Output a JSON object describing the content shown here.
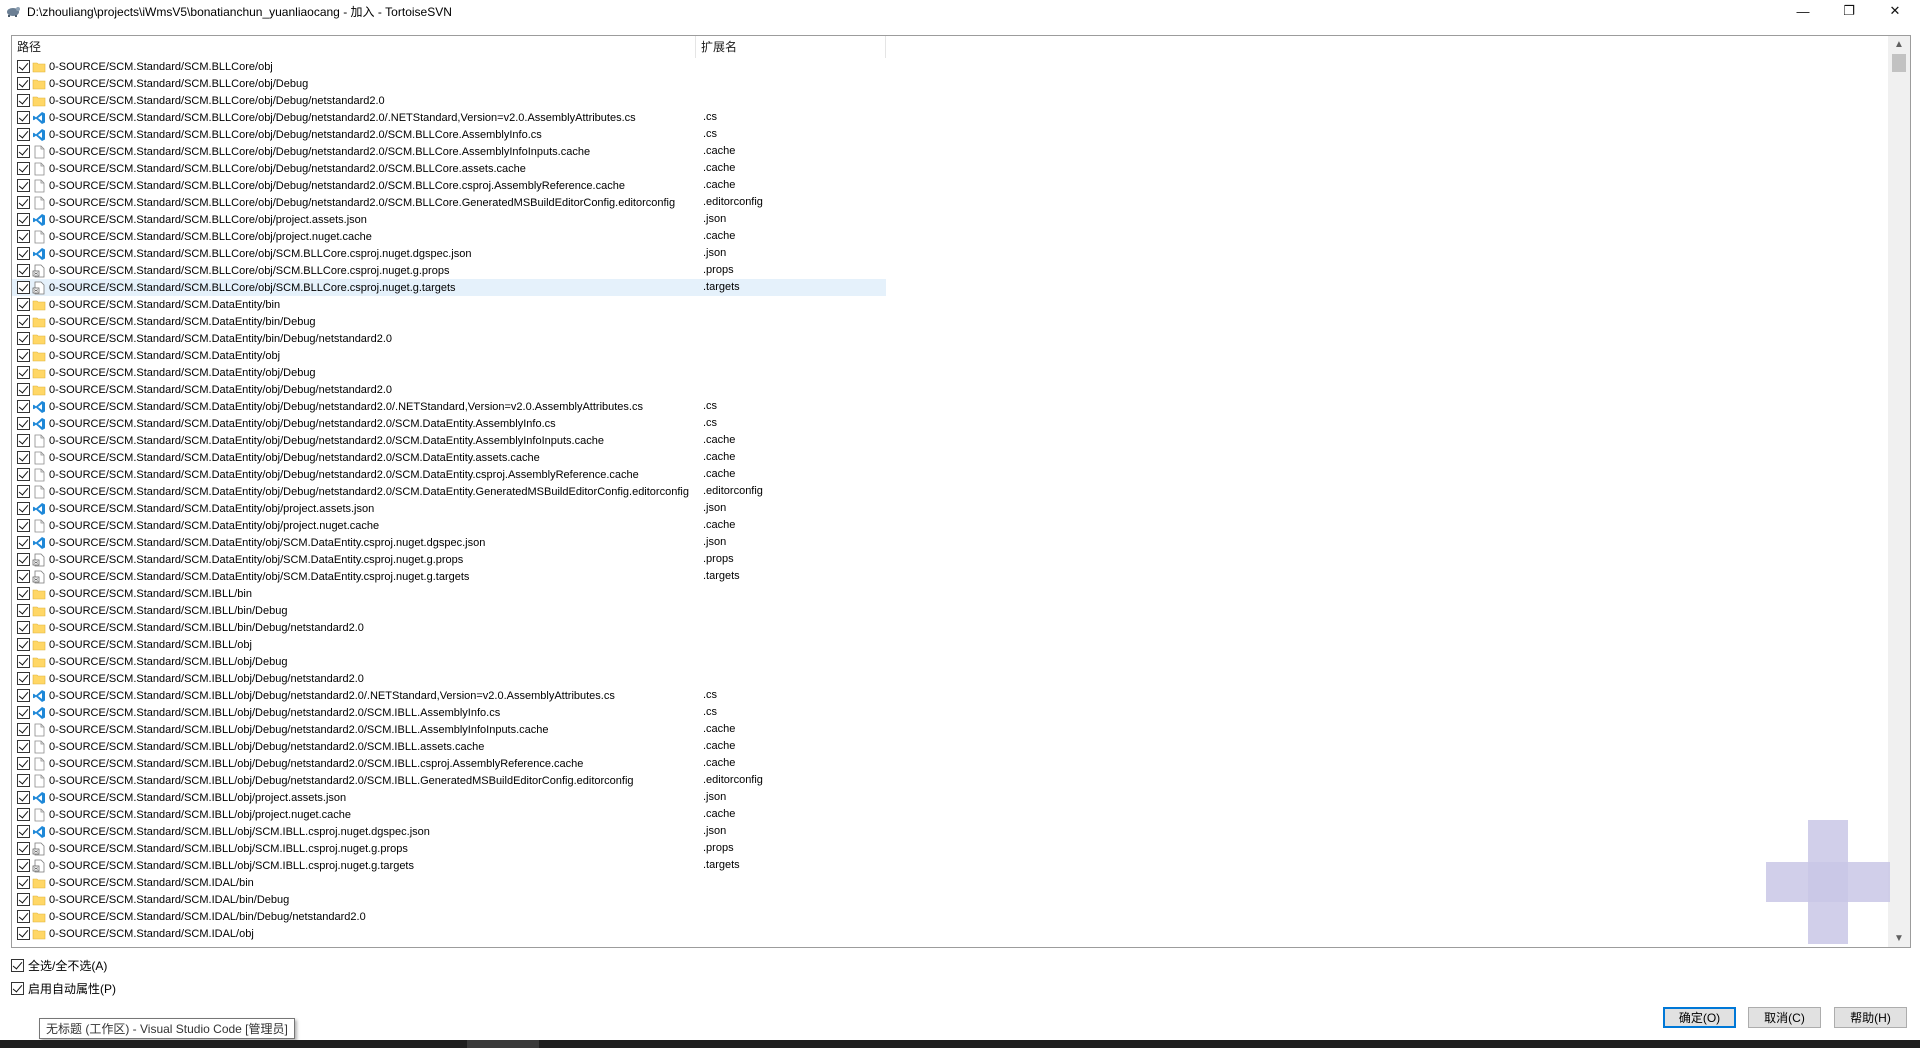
{
  "window": {
    "title": "D:\\zhouliang\\projects\\iWmsV5\\bonatianchun_yuanliaocang - 加入 - TortoiseSVN",
    "minimize_glyph": "—",
    "maximize_glyph": "❐",
    "close_glyph": "✕"
  },
  "list": {
    "columns": {
      "path": "路径",
      "ext": "扩展名"
    },
    "rows": [
      {
        "path": "0-SOURCE/SCM.Standard/SCM.BLLCore/obj",
        "ext": "",
        "icon": "folder-icon"
      },
      {
        "path": "0-SOURCE/SCM.Standard/SCM.BLLCore/obj/Debug",
        "ext": "",
        "icon": "folder-icon"
      },
      {
        "path": "0-SOURCE/SCM.Standard/SCM.BLLCore/obj/Debug/netstandard2.0",
        "ext": "",
        "icon": "folder-icon"
      },
      {
        "path": "0-SOURCE/SCM.Standard/SCM.BLLCore/obj/Debug/netstandard2.0/.NETStandard,Version=v2.0.AssemblyAttributes.cs",
        "ext": ".cs",
        "icon": "vscode-icon"
      },
      {
        "path": "0-SOURCE/SCM.Standard/SCM.BLLCore/obj/Debug/netstandard2.0/SCM.BLLCore.AssemblyInfo.cs",
        "ext": ".cs",
        "icon": "vscode-icon"
      },
      {
        "path": "0-SOURCE/SCM.Standard/SCM.BLLCore/obj/Debug/netstandard2.0/SCM.BLLCore.AssemblyInfoInputs.cache",
        "ext": ".cache",
        "icon": "file-icon"
      },
      {
        "path": "0-SOURCE/SCM.Standard/SCM.BLLCore/obj/Debug/netstandard2.0/SCM.BLLCore.assets.cache",
        "ext": ".cache",
        "icon": "file-icon"
      },
      {
        "path": "0-SOURCE/SCM.Standard/SCM.BLLCore/obj/Debug/netstandard2.0/SCM.BLLCore.csproj.AssemblyReference.cache",
        "ext": ".cache",
        "icon": "file-icon"
      },
      {
        "path": "0-SOURCE/SCM.Standard/SCM.BLLCore/obj/Debug/netstandard2.0/SCM.BLLCore.GeneratedMSBuildEditorConfig.editorconfig",
        "ext": ".editorconfig",
        "icon": "file-icon"
      },
      {
        "path": "0-SOURCE/SCM.Standard/SCM.BLLCore/obj/project.assets.json",
        "ext": ".json",
        "icon": "vscode-icon"
      },
      {
        "path": "0-SOURCE/SCM.Standard/SCM.BLLCore/obj/project.nuget.cache",
        "ext": ".cache",
        "icon": "file-icon"
      },
      {
        "path": "0-SOURCE/SCM.Standard/SCM.BLLCore/obj/SCM.BLLCore.csproj.nuget.dgspec.json",
        "ext": ".json",
        "icon": "vscode-icon"
      },
      {
        "path": "0-SOURCE/SCM.Standard/SCM.BLLCore/obj/SCM.BLLCore.csproj.nuget.g.props",
        "ext": ".props",
        "icon": "xml-file-icon"
      },
      {
        "path": "0-SOURCE/SCM.Standard/SCM.BLLCore/obj/SCM.BLLCore.csproj.nuget.g.targets",
        "ext": ".targets",
        "icon": "xml-file-icon",
        "selected": true
      },
      {
        "path": "0-SOURCE/SCM.Standard/SCM.DataEntity/bin",
        "ext": "",
        "icon": "folder-icon"
      },
      {
        "path": "0-SOURCE/SCM.Standard/SCM.DataEntity/bin/Debug",
        "ext": "",
        "icon": "folder-icon"
      },
      {
        "path": "0-SOURCE/SCM.Standard/SCM.DataEntity/bin/Debug/netstandard2.0",
        "ext": "",
        "icon": "folder-icon"
      },
      {
        "path": "0-SOURCE/SCM.Standard/SCM.DataEntity/obj",
        "ext": "",
        "icon": "folder-icon"
      },
      {
        "path": "0-SOURCE/SCM.Standard/SCM.DataEntity/obj/Debug",
        "ext": "",
        "icon": "folder-icon"
      },
      {
        "path": "0-SOURCE/SCM.Standard/SCM.DataEntity/obj/Debug/netstandard2.0",
        "ext": "",
        "icon": "folder-icon"
      },
      {
        "path": "0-SOURCE/SCM.Standard/SCM.DataEntity/obj/Debug/netstandard2.0/.NETStandard,Version=v2.0.AssemblyAttributes.cs",
        "ext": ".cs",
        "icon": "vscode-icon"
      },
      {
        "path": "0-SOURCE/SCM.Standard/SCM.DataEntity/obj/Debug/netstandard2.0/SCM.DataEntity.AssemblyInfo.cs",
        "ext": ".cs",
        "icon": "vscode-icon"
      },
      {
        "path": "0-SOURCE/SCM.Standard/SCM.DataEntity/obj/Debug/netstandard2.0/SCM.DataEntity.AssemblyInfoInputs.cache",
        "ext": ".cache",
        "icon": "file-icon"
      },
      {
        "path": "0-SOURCE/SCM.Standard/SCM.DataEntity/obj/Debug/netstandard2.0/SCM.DataEntity.assets.cache",
        "ext": ".cache",
        "icon": "file-icon"
      },
      {
        "path": "0-SOURCE/SCM.Standard/SCM.DataEntity/obj/Debug/netstandard2.0/SCM.DataEntity.csproj.AssemblyReference.cache",
        "ext": ".cache",
        "icon": "file-icon"
      },
      {
        "path": "0-SOURCE/SCM.Standard/SCM.DataEntity/obj/Debug/netstandard2.0/SCM.DataEntity.GeneratedMSBuildEditorConfig.editorconfig",
        "ext": ".editorconfig",
        "icon": "file-icon"
      },
      {
        "path": "0-SOURCE/SCM.Standard/SCM.DataEntity/obj/project.assets.json",
        "ext": ".json",
        "icon": "vscode-icon"
      },
      {
        "path": "0-SOURCE/SCM.Standard/SCM.DataEntity/obj/project.nuget.cache",
        "ext": ".cache",
        "icon": "file-icon"
      },
      {
        "path": "0-SOURCE/SCM.Standard/SCM.DataEntity/obj/SCM.DataEntity.csproj.nuget.dgspec.json",
        "ext": ".json",
        "icon": "vscode-icon"
      },
      {
        "path": "0-SOURCE/SCM.Standard/SCM.DataEntity/obj/SCM.DataEntity.csproj.nuget.g.props",
        "ext": ".props",
        "icon": "xml-file-icon"
      },
      {
        "path": "0-SOURCE/SCM.Standard/SCM.DataEntity/obj/SCM.DataEntity.csproj.nuget.g.targets",
        "ext": ".targets",
        "icon": "xml-file-icon"
      },
      {
        "path": "0-SOURCE/SCM.Standard/SCM.IBLL/bin",
        "ext": "",
        "icon": "folder-icon"
      },
      {
        "path": "0-SOURCE/SCM.Standard/SCM.IBLL/bin/Debug",
        "ext": "",
        "icon": "folder-icon"
      },
      {
        "path": "0-SOURCE/SCM.Standard/SCM.IBLL/bin/Debug/netstandard2.0",
        "ext": "",
        "icon": "folder-icon"
      },
      {
        "path": "0-SOURCE/SCM.Standard/SCM.IBLL/obj",
        "ext": "",
        "icon": "folder-icon"
      },
      {
        "path": "0-SOURCE/SCM.Standard/SCM.IBLL/obj/Debug",
        "ext": "",
        "icon": "folder-icon"
      },
      {
        "path": "0-SOURCE/SCM.Standard/SCM.IBLL/obj/Debug/netstandard2.0",
        "ext": "",
        "icon": "folder-icon"
      },
      {
        "path": "0-SOURCE/SCM.Standard/SCM.IBLL/obj/Debug/netstandard2.0/.NETStandard,Version=v2.0.AssemblyAttributes.cs",
        "ext": ".cs",
        "icon": "vscode-icon"
      },
      {
        "path": "0-SOURCE/SCM.Standard/SCM.IBLL/obj/Debug/netstandard2.0/SCM.IBLL.AssemblyInfo.cs",
        "ext": ".cs",
        "icon": "vscode-icon"
      },
      {
        "path": "0-SOURCE/SCM.Standard/SCM.IBLL/obj/Debug/netstandard2.0/SCM.IBLL.AssemblyInfoInputs.cache",
        "ext": ".cache",
        "icon": "file-icon"
      },
      {
        "path": "0-SOURCE/SCM.Standard/SCM.IBLL/obj/Debug/netstandard2.0/SCM.IBLL.assets.cache",
        "ext": ".cache",
        "icon": "file-icon"
      },
      {
        "path": "0-SOURCE/SCM.Standard/SCM.IBLL/obj/Debug/netstandard2.0/SCM.IBLL.csproj.AssemblyReference.cache",
        "ext": ".cache",
        "icon": "file-icon"
      },
      {
        "path": "0-SOURCE/SCM.Standard/SCM.IBLL/obj/Debug/netstandard2.0/SCM.IBLL.GeneratedMSBuildEditorConfig.editorconfig",
        "ext": ".editorconfig",
        "icon": "file-icon"
      },
      {
        "path": "0-SOURCE/SCM.Standard/SCM.IBLL/obj/project.assets.json",
        "ext": ".json",
        "icon": "vscode-icon"
      },
      {
        "path": "0-SOURCE/SCM.Standard/SCM.IBLL/obj/project.nuget.cache",
        "ext": ".cache",
        "icon": "file-icon"
      },
      {
        "path": "0-SOURCE/SCM.Standard/SCM.IBLL/obj/SCM.IBLL.csproj.nuget.dgspec.json",
        "ext": ".json",
        "icon": "vscode-icon"
      },
      {
        "path": "0-SOURCE/SCM.Standard/SCM.IBLL/obj/SCM.IBLL.csproj.nuget.g.props",
        "ext": ".props",
        "icon": "xml-file-icon"
      },
      {
        "path": "0-SOURCE/SCM.Standard/SCM.IBLL/obj/SCM.IBLL.csproj.nuget.g.targets",
        "ext": ".targets",
        "icon": "xml-file-icon"
      },
      {
        "path": "0-SOURCE/SCM.Standard/SCM.IDAL/bin",
        "ext": "",
        "icon": "folder-icon"
      },
      {
        "path": "0-SOURCE/SCM.Standard/SCM.IDAL/bin/Debug",
        "ext": "",
        "icon": "folder-icon"
      },
      {
        "path": "0-SOURCE/SCM.Standard/SCM.IDAL/bin/Debug/netstandard2.0",
        "ext": "",
        "icon": "folder-icon"
      },
      {
        "path": "0-SOURCE/SCM.Standard/SCM.IDAL/obj",
        "ext": "",
        "icon": "folder-icon"
      }
    ]
  },
  "options": {
    "select_all": "全选/全不选(A)",
    "auto_props": "启用自动属性(P)"
  },
  "buttons": {
    "ok": "确定(O)",
    "cancel": "取消(C)",
    "help": "帮助(H)"
  },
  "tooltip": {
    "text": "无标题 (工作区) - Visual Studio Code [管理员]"
  },
  "colors": {
    "selection": "#e5f1fb",
    "folder": "#ffd766",
    "vscode_blue": "#1e88d8",
    "default_button_border": "#0078d7"
  }
}
